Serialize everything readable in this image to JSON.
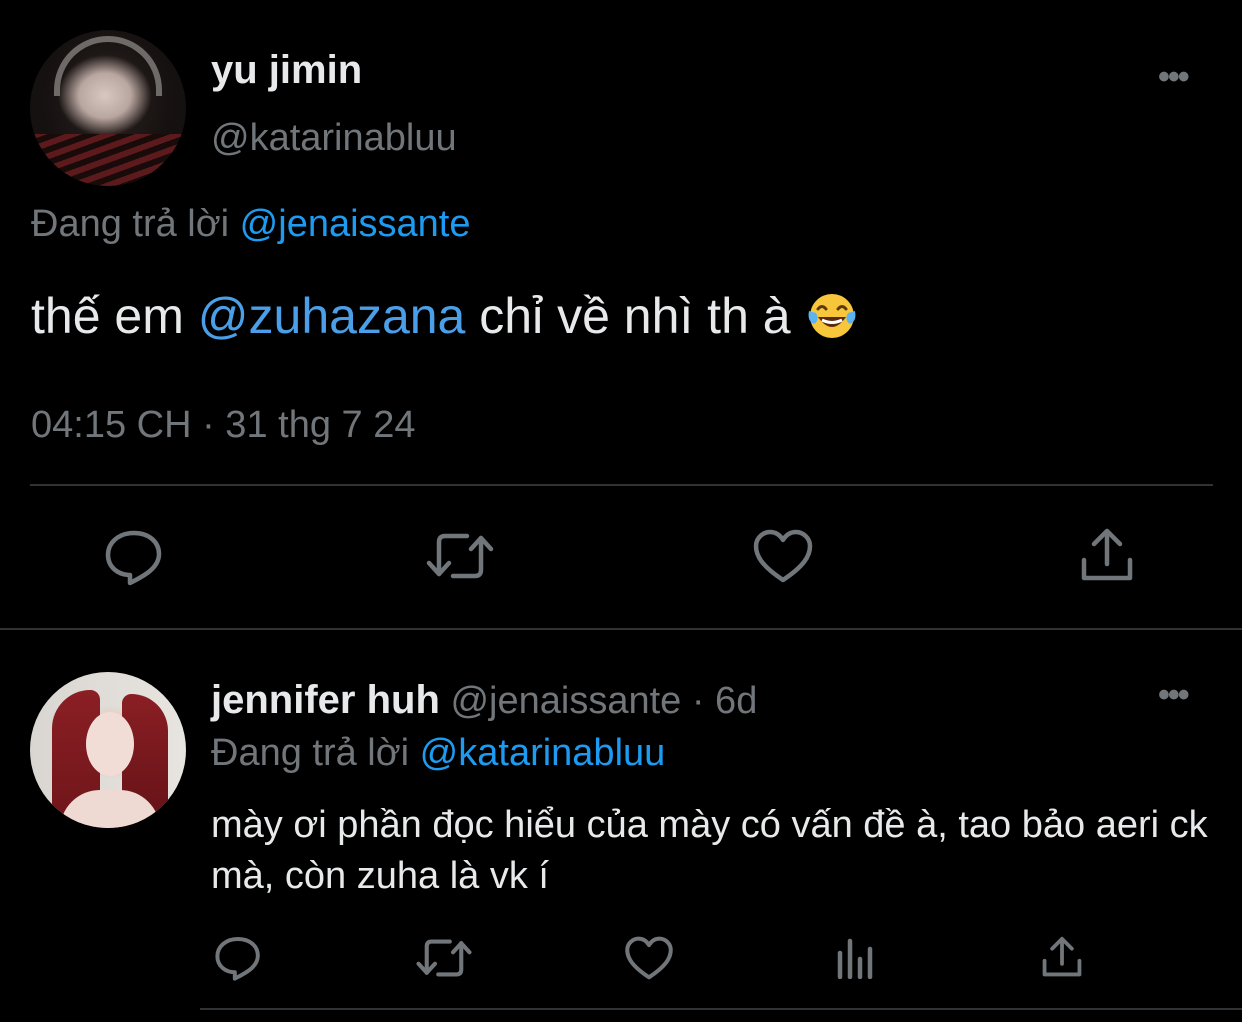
{
  "main_tweet": {
    "display_name": "yu jimin",
    "handle": "@katarinabluu",
    "replying_prefix": "Đang trả lời",
    "replying_to": "@jenaissante",
    "text_before": "thế em",
    "mention": "@zuhazana",
    "text_after": "chỉ về nhì th à",
    "emoji_icon": "face-with-tears-of-joy-icon",
    "timestamp": "04:15 CH · 31 thg 7 24",
    "more_label": "•••"
  },
  "reply_tweet": {
    "display_name": "jennifer huh",
    "handle": "@jenaissante",
    "age": "· 6d",
    "replying_prefix": "Đang trả lời",
    "replying_to": "@katarinabluu",
    "text": "mày ơi phần đọc hiểu của mày có vấn đề à, tao bảo aeri ck mà, còn zuha là vk í",
    "more_label": "•••"
  },
  "icons": {
    "reply": "speech-bubble-icon",
    "retweet": "retweet-icon",
    "like": "heart-icon",
    "views": "bar-chart-icon",
    "share": "share-upload-icon",
    "more": "more-dots-icon"
  },
  "colors": {
    "background": "#000000",
    "text_primary": "#e7e9ea",
    "text_secondary": "#71767b",
    "link": "#1d9bf0",
    "divider": "#2f3336"
  }
}
